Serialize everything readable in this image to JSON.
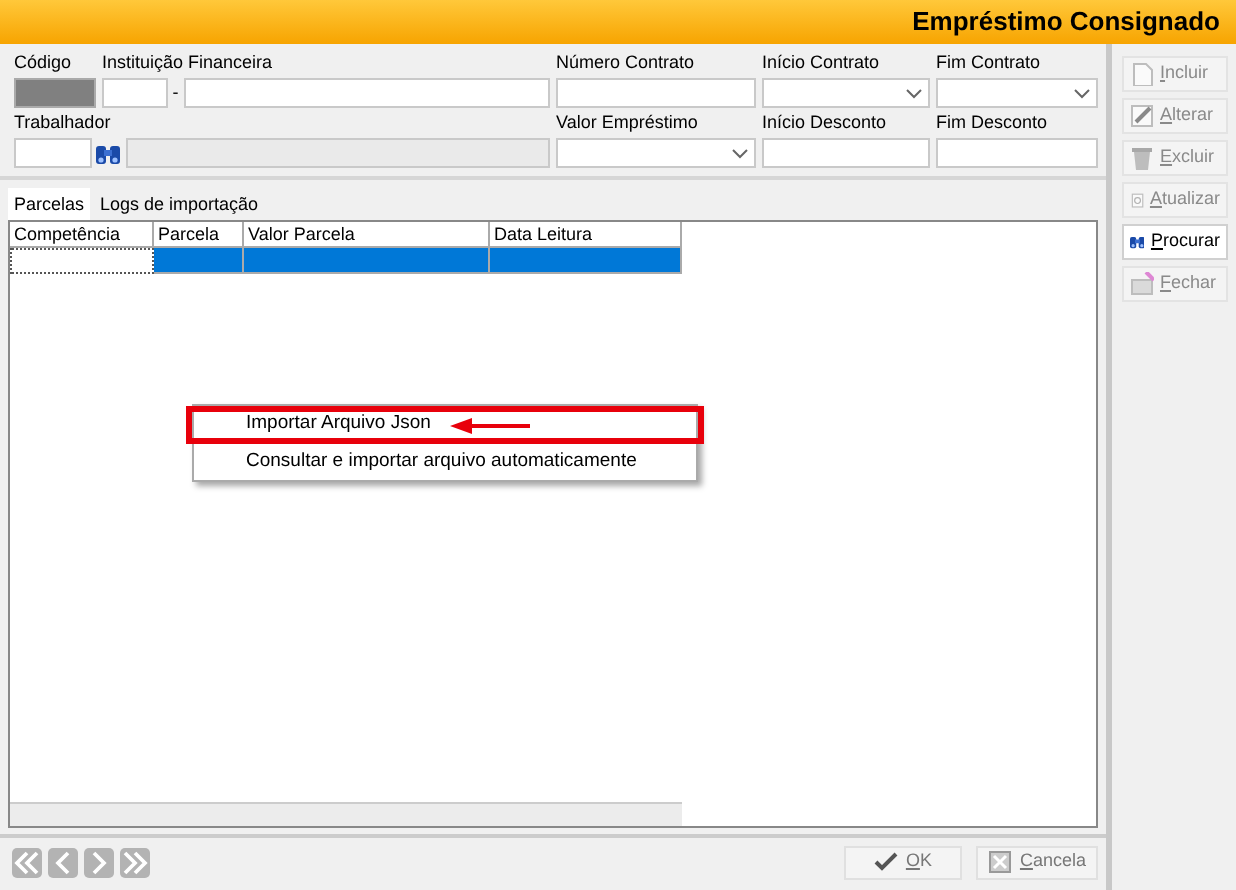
{
  "window": {
    "title": "Empréstimo Consignado"
  },
  "form": {
    "fields": [
      {
        "kind": "locked",
        "label": "Código"
      },
      {
        "kind": "pair",
        "label": "Instituição Financeira",
        "separator": "-"
      },
      {
        "kind": "text",
        "label": "Número Contrato"
      },
      {
        "kind": "dropdown",
        "label": "Início Contrato"
      },
      {
        "kind": "dropdown",
        "label": "Fim Contrato"
      },
      {
        "kind": "lookup",
        "label": "Trabalhador"
      },
      {
        "kind": "dropdown",
        "label": "Valor Empréstimo"
      },
      {
        "kind": "text",
        "label": "Início Desconto"
      },
      {
        "kind": "text",
        "label": "Fim Desconto"
      }
    ]
  },
  "tabs": [
    {
      "label": "Parcelas",
      "selected": true
    },
    {
      "label": "Logs de importação",
      "selected": false
    }
  ],
  "table": {
    "columns": [
      "Competência",
      "Parcela",
      "Valor Parcela",
      "Data Leitura"
    ],
    "rows": [
      {
        "selected": true
      }
    ]
  },
  "context_menu": {
    "items": [
      {
        "label": "Importar Arquivo Json",
        "highlighted": true
      },
      {
        "label": "Consultar e importar arquivo automaticamente",
        "highlighted": false
      }
    ]
  },
  "side_buttons": [
    {
      "label": "Incluir",
      "disabled": true
    },
    {
      "label": "Alterar",
      "disabled": true
    },
    {
      "label": "Excluir",
      "disabled": true
    },
    {
      "label": "Atualizar",
      "disabled": true
    },
    {
      "label": "Procurar",
      "disabled": false
    },
    {
      "label": "Fechar",
      "disabled": true
    }
  ],
  "nav_buttons": [
    {
      "disabled": true
    },
    {
      "disabled": true
    },
    {
      "disabled": true
    },
    {
      "disabled": true
    }
  ],
  "footer_buttons": [
    {
      "label": "OK",
      "disabled": true
    },
    {
      "label": "Cancela",
      "disabled": true
    }
  ]
}
